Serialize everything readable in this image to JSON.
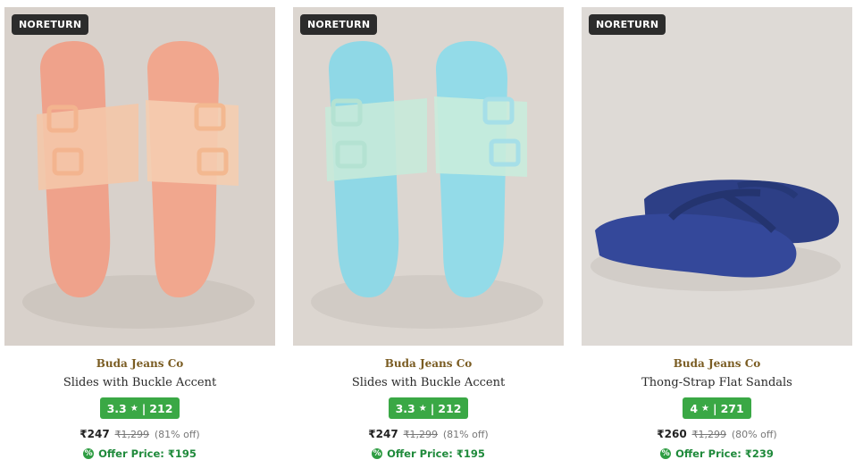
{
  "products": [
    {
      "badge": "NORETURN",
      "brand": "Buda Jeans Co",
      "title": "Slides with Buckle Accent",
      "rating": "3.3",
      "rating_count": "212",
      "price": "₹247",
      "mrp": "₹1,299",
      "discount": "(81% off)",
      "offer_label": "Offer Price: ₹195",
      "image_subject": "peach-slides",
      "colors": {
        "bg": "#d8d1cb",
        "product": "#f0a58a"
      }
    },
    {
      "badge": "NORETURN",
      "brand": "Buda Jeans Co",
      "title": "Slides with Buckle Accent",
      "rating": "3.3",
      "rating_count": "212",
      "price": "₹247",
      "mrp": "₹1,299",
      "discount": "(81% off)",
      "offer_label": "Offer Price: ₹195",
      "image_subject": "aqua-slides",
      "colors": {
        "bg": "#dcd6d0",
        "product": "#8fd8e6"
      }
    },
    {
      "badge": "NORETURN",
      "brand": "Buda Jeans Co",
      "title": "Thong-Strap Flat Sandals",
      "rating": "4",
      "rating_count": "271",
      "price": "₹260",
      "mrp": "₹1,299",
      "discount": "(80% off)",
      "offer_label": "Offer Price: ₹239",
      "image_subject": "navy-thong-sandals",
      "colors": {
        "bg": "#dedad6",
        "product": "#2d3f86"
      }
    }
  ],
  "icons": {
    "rating_star": "star-icon",
    "offer": "tag-icon"
  },
  "colors": {
    "brand_text": "#7a5c22",
    "rating_badge": "#3aa845",
    "offer_text": "#1f8a3b",
    "badge_bg": "#2c2c2c"
  }
}
